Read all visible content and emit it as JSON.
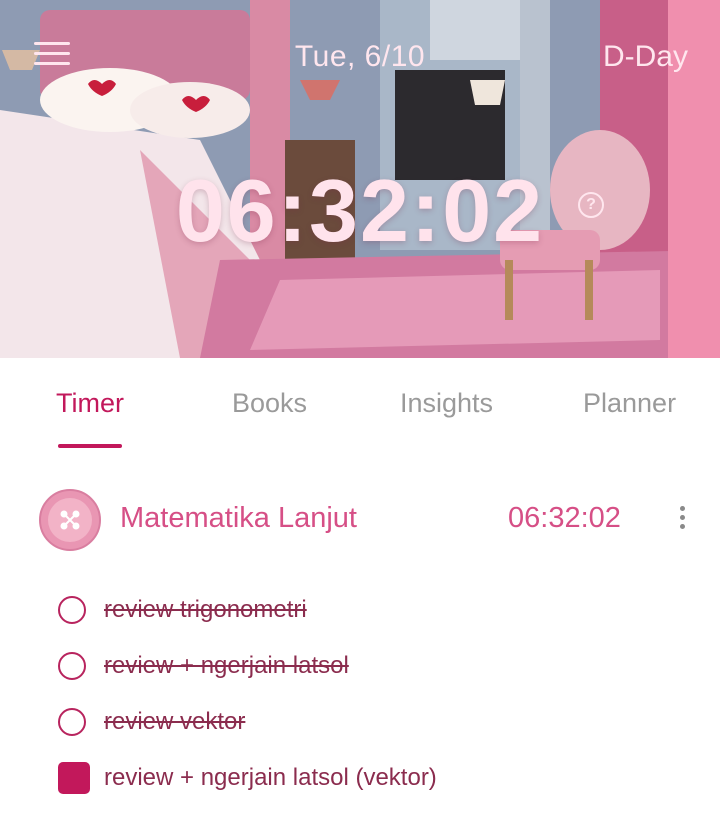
{
  "header": {
    "date": "Tue, 6/10",
    "dday_label": "D-Day",
    "timer": "06:32:02",
    "help_glyph": "?",
    "menu_icon": "hamburger-icon",
    "accent_color": "#f08fae"
  },
  "tabs": [
    {
      "label": "Timer",
      "active": true
    },
    {
      "label": "Books",
      "active": false
    },
    {
      "label": "Insights",
      "active": false
    },
    {
      "label": "Planner",
      "active": false
    }
  ],
  "subject": {
    "icon": "pink-button-icon",
    "name": "Matematika Lanjut",
    "time": "06:32:02",
    "color": "#d64f86"
  },
  "tasks": [
    {
      "label": "review trigonometri",
      "done": true
    },
    {
      "label": "review + ngerjain latsol",
      "done": true
    },
    {
      "label": "review vektor",
      "done": true
    },
    {
      "label": "review + ngerjain latsol (vektor)",
      "done": false
    }
  ],
  "colors": {
    "primary": "#c2185b",
    "inactive_tab": "#9a9a9a",
    "task_text": "#8b2c4e"
  }
}
